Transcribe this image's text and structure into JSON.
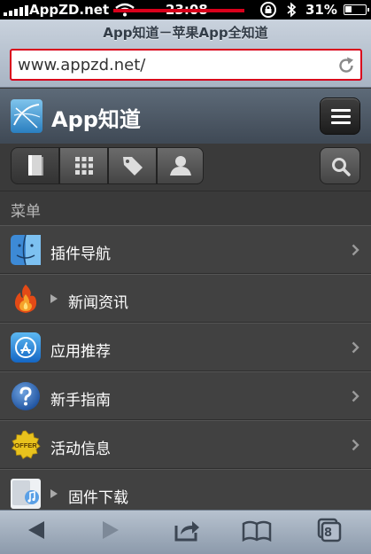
{
  "status_bar": {
    "carrier": "AppZD.net",
    "time": "23:08",
    "battery_percent": "31%",
    "battery_level": 0.31
  },
  "browser": {
    "page_title": "App知道－苹果App全知道",
    "url": "www.appzd.net/"
  },
  "site": {
    "brand": "App知道"
  },
  "tabs": [
    {
      "icon": "book-icon",
      "active": true
    },
    {
      "icon": "grid-icon",
      "active": false
    },
    {
      "icon": "tag-icon",
      "active": false
    },
    {
      "icon": "person-icon",
      "active": false
    }
  ],
  "menu": {
    "heading": "菜单",
    "items": [
      {
        "label": "插件导航",
        "icon": "finder-icon",
        "has_triangle": false,
        "has_chevron": true
      },
      {
        "label": "新闻资讯",
        "icon": "fire-icon",
        "has_triangle": true,
        "has_chevron": false
      },
      {
        "label": "应用推荐",
        "icon": "app-store-icon",
        "has_triangle": false,
        "has_chevron": true
      },
      {
        "label": "新手指南",
        "icon": "help-icon",
        "has_triangle": false,
        "has_chevron": true
      },
      {
        "label": "活动信息",
        "icon": "offer-badge-icon",
        "has_triangle": false,
        "has_chevron": true
      },
      {
        "label": "固件下载",
        "icon": "itunes-icon",
        "has_triangle": true,
        "has_chevron": false
      }
    ]
  },
  "toolbar": {
    "tabs_count": "8",
    "offer_badge_text": "OFFER"
  },
  "colors": {
    "highlight_red": "#d9001b",
    "menu_background": "#414141"
  }
}
